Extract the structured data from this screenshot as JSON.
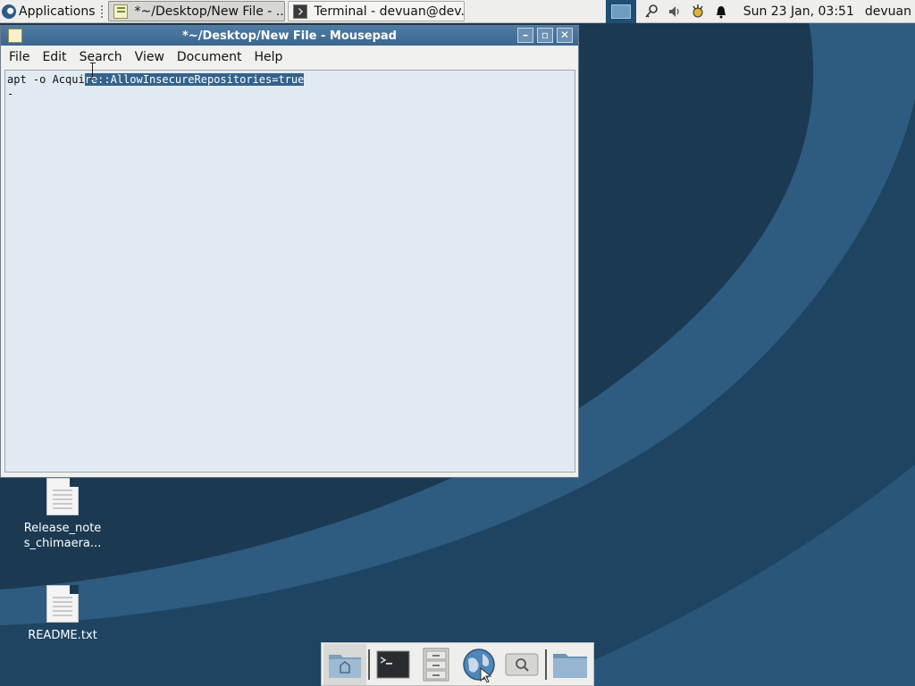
{
  "top_panel": {
    "applications_label": "Applications",
    "tasks": [
      {
        "label": "*~/Desktop/New File - ...",
        "icon": "mousepad-icon",
        "active": true
      },
      {
        "label": "Terminal - devuan@dev...",
        "icon": "terminal-icon",
        "active": false
      }
    ],
    "clock": "Sun 23 Jan, 03:51",
    "user": "devuan"
  },
  "window": {
    "title": "*~/Desktop/New File - Mousepad",
    "menu": [
      "File",
      "Edit",
      "Search",
      "View",
      "Document",
      "Help"
    ],
    "editor": {
      "text_before_selection": "apt -o Acqui",
      "selected_text": "re::AllowInsecureRepositories=true",
      "line2": "-"
    }
  },
  "desktop_icons": [
    {
      "label": "Release_note\ns_chimaera..."
    },
    {
      "label": "README.txt"
    }
  ],
  "dock": [
    "home-folder",
    "terminal",
    "file-cabinet",
    "web-browser",
    "search",
    "folder"
  ],
  "colors": {
    "panel": "#eeeeec",
    "titlebar": "#3b678f",
    "selection": "#34628c",
    "editor_bg": "#e1eaf2",
    "desktop": "#1b3a52"
  }
}
